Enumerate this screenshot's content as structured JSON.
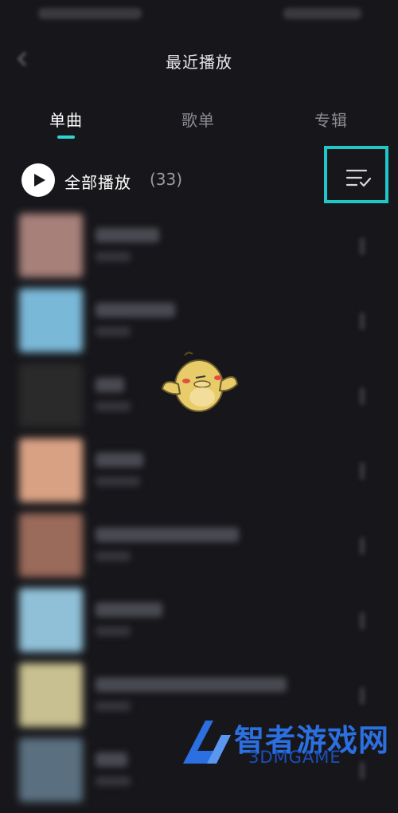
{
  "header": {
    "title": "最近播放"
  },
  "tabs": [
    {
      "label": "单曲",
      "active": true
    },
    {
      "label": "歌单",
      "active": false
    },
    {
      "label": "专辑",
      "active": false
    }
  ],
  "toolbar": {
    "play_all_label": "全部播放",
    "count": "(33)"
  },
  "songs": [
    {
      "cover_color": "#a7807a"
    },
    {
      "cover_color": "#7ab8d8"
    },
    {
      "cover_color": "#2a2a2a"
    },
    {
      "cover_color": "#d9a184"
    },
    {
      "cover_color": "#9a6a5a"
    },
    {
      "cover_color": "#90c0d8"
    },
    {
      "cover_color": "#c8c090"
    },
    {
      "cover_color": "#5a7080"
    }
  ],
  "watermark": {
    "text": "智者游戏网",
    "sub": "3DMGAME"
  },
  "colors": {
    "accent": "#2fd3d3",
    "highlight": "#1fc7c9",
    "background": "#17171b"
  }
}
